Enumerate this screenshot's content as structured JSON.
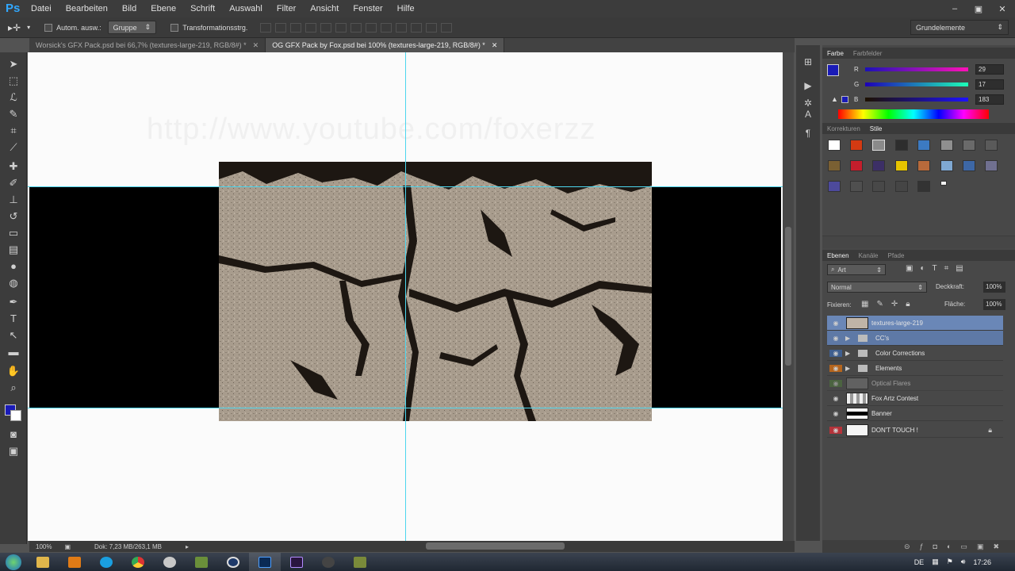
{
  "app": {
    "logo": "Ps"
  },
  "menu": [
    "Datei",
    "Bearbeiten",
    "Bild",
    "Ebene",
    "Schrift",
    "Auswahl",
    "Filter",
    "Ansicht",
    "Fenster",
    "Hilfe"
  ],
  "window_buttons": [
    "–",
    "▣",
    "✕"
  ],
  "options": {
    "auto_select_label": "Autom. ausw.:",
    "auto_select_value": "Gruppe",
    "transform_label": "Transformationsstrg.",
    "workspace": "Grundelemente"
  },
  "tabs": [
    {
      "label": "Worsick's GFX Pack.psd bei 66,7% (textures-large-219, RGB/8#) *",
      "close": "✕"
    },
    {
      "label": "OG GFX Pack by Fox.psd bei 100% (textures-large-219, RGB/8#) *",
      "close": "✕"
    }
  ],
  "canvas": {
    "watermark": "http://www.youtube.com/foxerzz"
  },
  "status": {
    "zoom": "100%",
    "doc": "Dok: 7,23 MB/263,1 MB"
  },
  "color_panel": {
    "tabs": [
      "Farbe",
      "Farbfelder"
    ],
    "fg_color": "#1a1bb7",
    "channels": [
      {
        "label": "R",
        "value": "29"
      },
      {
        "label": "G",
        "value": "17"
      },
      {
        "label": "B",
        "value": "183"
      }
    ]
  },
  "styles_panel": {
    "tabs": [
      "Korrekturen",
      "Stile"
    ]
  },
  "layers_panel": {
    "tabs": [
      "Ebenen",
      "Kanäle",
      "Pfade"
    ],
    "filter_kind": "Art",
    "blend_mode": "Normal",
    "opacity_label": "Deckkraft:",
    "opacity_value": "100%",
    "lock_label": "Fixieren:",
    "fill_label": "Fläche:",
    "fill_value": "100%",
    "layers": [
      {
        "name": "textures-large-219",
        "type": "layer",
        "selected": true
      },
      {
        "name": "CC's",
        "type": "group",
        "selected": true
      },
      {
        "name": "Color Corrections",
        "type": "group",
        "selected": false
      },
      {
        "name": "Elements",
        "type": "group",
        "selected": false
      },
      {
        "name": "Optical Flares",
        "type": "layer",
        "selected": false
      },
      {
        "name": "Fox Artz Contest",
        "type": "layer",
        "selected": false
      },
      {
        "name": "Banner",
        "type": "layer",
        "selected": false
      },
      {
        "name": "DON'T TOUCH !",
        "type": "layer",
        "selected": false,
        "locked": true
      }
    ]
  },
  "taskbar": {
    "lang": "DE",
    "time": "17:26"
  }
}
